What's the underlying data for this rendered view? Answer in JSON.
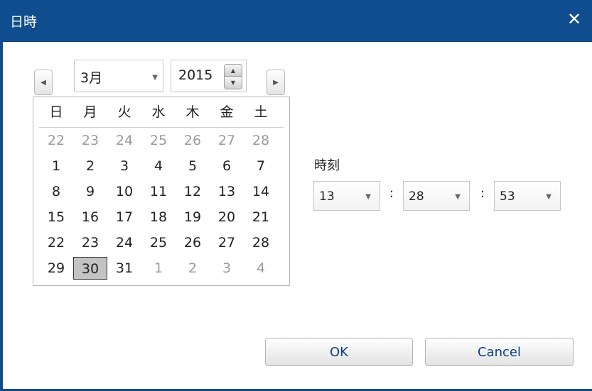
{
  "dialog": {
    "title": "日時",
    "close_label": "✕"
  },
  "calendar": {
    "prev_icon": "◀",
    "next_icon": "▶",
    "month": "3月",
    "year": "2015",
    "weekdays": [
      "日",
      "月",
      "火",
      "水",
      "木",
      "金",
      "土"
    ],
    "weeks": [
      [
        [
          "22",
          true
        ],
        [
          "23",
          true
        ],
        [
          "24",
          true
        ],
        [
          "25",
          true
        ],
        [
          "26",
          true
        ],
        [
          "27",
          true
        ],
        [
          "28",
          true
        ]
      ],
      [
        [
          "1",
          false
        ],
        [
          "2",
          false
        ],
        [
          "3",
          false
        ],
        [
          "4",
          false
        ],
        [
          "5",
          false
        ],
        [
          "6",
          false
        ],
        [
          "7",
          false
        ]
      ],
      [
        [
          "8",
          false
        ],
        [
          "9",
          false
        ],
        [
          "10",
          false
        ],
        [
          "11",
          false
        ],
        [
          "12",
          false
        ],
        [
          "13",
          false
        ],
        [
          "14",
          false
        ]
      ],
      [
        [
          "15",
          false
        ],
        [
          "16",
          false
        ],
        [
          "17",
          false
        ],
        [
          "18",
          false
        ],
        [
          "19",
          false
        ],
        [
          "20",
          false
        ],
        [
          "21",
          false
        ]
      ],
      [
        [
          "22",
          false
        ],
        [
          "23",
          false
        ],
        [
          "24",
          false
        ],
        [
          "25",
          false
        ],
        [
          "26",
          false
        ],
        [
          "27",
          false
        ],
        [
          "28",
          false
        ]
      ],
      [
        [
          "29",
          false
        ],
        [
          "30",
          false
        ],
        [
          "31",
          false
        ],
        [
          "1",
          true
        ],
        [
          "2",
          true
        ],
        [
          "3",
          true
        ],
        [
          "4",
          true
        ]
      ]
    ],
    "selected_day": "30"
  },
  "time": {
    "label": "時刻",
    "hour": "13",
    "minute": "28",
    "second": "53",
    "separator": ":"
  },
  "buttons": {
    "ok": "OK",
    "cancel": "Cancel"
  },
  "colors": {
    "titlebar": "#0f4d8f",
    "selected_bg": "#c3c3c3",
    "button_text": "#0b3f86"
  }
}
